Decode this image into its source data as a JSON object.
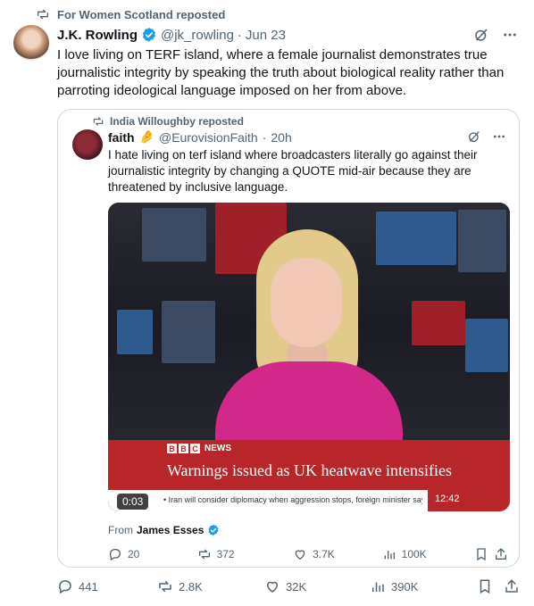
{
  "repost": {
    "label": "For Women Scotland reposted"
  },
  "tweet": {
    "name": "J.K. Rowling",
    "handle": "@jk_rowling",
    "separator": "·",
    "date": "Jun 23",
    "text": "I love living on TERF island, where a female journalist demonstrates true journalistic integrity by speaking the truth about biological reality rather than parroting ideological language imposed on her from above."
  },
  "quote": {
    "repost_label": "India Willoughby reposted",
    "name": "faith",
    "emoji": "🤌",
    "handle": "@EurovisionFaith",
    "separator": "·",
    "time": "20h",
    "text": "I hate living on terf island where broadcasters literally go against their journalistic integrity by changing a QUOTE mid-air because they are threatened by inclusive language.",
    "video": {
      "bbc_letters": [
        "B",
        "B",
        "C"
      ],
      "bbc_news": "NEWS",
      "headline": "Warnings issued as UK heatwave intensifies",
      "ticker": "• Iran will consider diplomacy when aggression stops, foreign minister says",
      "clock": "12:42",
      "duration": "0:03"
    },
    "from_label": "From",
    "from_name": "James Esses",
    "actions": {
      "replies": "20",
      "reposts": "372",
      "likes": "3.7K",
      "views": "100K"
    }
  },
  "actions": {
    "replies": "441",
    "reposts": "2.8K",
    "likes": "32K",
    "views": "390K"
  },
  "colors": {
    "accent": "#1d9bf0",
    "muted": "#536471",
    "border": "#cfd9de",
    "bbc_red": "#b8262a"
  }
}
